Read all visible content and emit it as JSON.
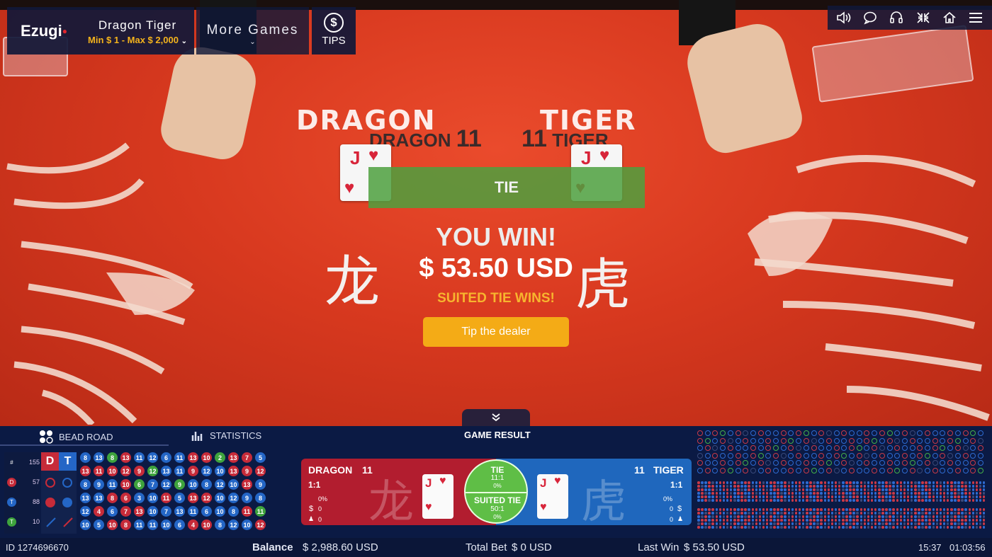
{
  "header": {
    "logo": "Ezugi",
    "game_name": "Dragon Tiger",
    "limits": "Min $ 1 - Max $ 2,000",
    "more_games": "More Games",
    "tips": "TIPS",
    "tips_symbol": "$",
    "icons": [
      "sound-icon",
      "chat-icon",
      "support-icon",
      "minimize-icon",
      "home-icon",
      "menu-icon"
    ]
  },
  "table": {
    "dragon_label": "DRAGON",
    "tiger_label": "TIGER",
    "dragon_score_label": "DRAGON",
    "dragon_score": "11",
    "tiger_score": "11",
    "tiger_score_label": "TIGER",
    "dragon_card": {
      "rank": "J",
      "suit": "♥"
    },
    "tiger_card": {
      "rank": "J",
      "suit": "♥"
    },
    "result_banner": "TIE",
    "win_title": "YOU WIN!",
    "win_amount": "$ 53.50 USD",
    "win_sub": "SUITED TIE WINS!",
    "tip_button": "Tip the dealer",
    "dragon_char": "龙",
    "tiger_char": "虎"
  },
  "bottom": {
    "tabs": {
      "bead_road": "BEAD ROAD",
      "statistics": "STATISTICS",
      "game_result": "GAME RESULT"
    },
    "stats": [
      {
        "symbol": "#",
        "value": "155",
        "color": "#0b1a44"
      },
      {
        "symbol": "D",
        "value": "57",
        "color": "#c62b39"
      },
      {
        "symbol": "T",
        "value": "88",
        "color": "#2466c6"
      },
      {
        "symbol": "T",
        "value": "10",
        "color": "#3ea33d"
      }
    ],
    "dt_header": {
      "d": "D",
      "t": "T"
    },
    "bead_rows": [
      [
        "8b",
        "13b",
        "8g",
        "13r",
        "11b",
        "12b",
        "6b",
        "11b",
        "13r",
        "10r",
        "2g",
        "13r",
        "7r",
        "5b"
      ],
      [
        "13r",
        "11r",
        "10r",
        "12r",
        "9r",
        "12g",
        "13b",
        "11b",
        "9r",
        "12b",
        "10b",
        "13r",
        "9r",
        "12r"
      ],
      [
        "8b",
        "9b",
        "11b",
        "10r",
        "6g",
        "7b",
        "12b",
        "9g",
        "10b",
        "8b",
        "12b",
        "10b",
        "13r",
        "9b"
      ],
      [
        "13b",
        "13b",
        "8r",
        "6r",
        "3b",
        "10b",
        "11r",
        "5b",
        "13r",
        "12r",
        "10b",
        "12b",
        "9b",
        "8b"
      ],
      [
        "12b",
        "4r",
        "6b",
        "7r",
        "13r",
        "10b",
        "7b",
        "13b",
        "11b",
        "6b",
        "10b",
        "8b",
        "11r",
        "11g"
      ],
      [
        "10b",
        "5b",
        "10r",
        "8r",
        "11b",
        "11b",
        "10b",
        "6b",
        "4r",
        "10r",
        "8b",
        "12b",
        "10b",
        "12r"
      ]
    ],
    "result": {
      "dragon_label": "DRAGON",
      "dragon_score": "11",
      "dragon_payout": "1:1",
      "dragon_pct": "0%",
      "dragon_amount": "0",
      "dragon_players": "0",
      "dragon_card_rank": "J",
      "dragon_card_suit": "♥",
      "dragon_char": "龙",
      "tie_label": "TIE",
      "tie_payout": "11:1",
      "tie_pct": "0%",
      "suited_tie_label": "SUITED TIE",
      "suited_tie_payout": "50:1",
      "suited_tie_pct": "0%",
      "tiger_label": "TIGER",
      "tiger_score": "11",
      "tiger_payout": "1:1",
      "tiger_pct": "0%",
      "tiger_amount": "0",
      "tiger_players": "0",
      "tiger_card_rank": "J",
      "tiger_card_suit": "♥",
      "tiger_char": "虎"
    }
  },
  "footer": {
    "id": "ID 1274696670",
    "balance_label": "Balance",
    "balance": "$ 2,988.60 USD",
    "total_bet_label": "Total Bet",
    "total_bet": "$ 0 USD",
    "last_win_label": "Last Win",
    "last_win": "$ 53.50 USD",
    "time": "15:37",
    "session_time": "01:03:56"
  },
  "colors": {
    "dragon_red": "#c62b39",
    "tiger_blue": "#2466c6",
    "tie_green": "#3ea33d",
    "accent_gold": "#f4ab16",
    "panel_navy": "#0b1a44"
  }
}
